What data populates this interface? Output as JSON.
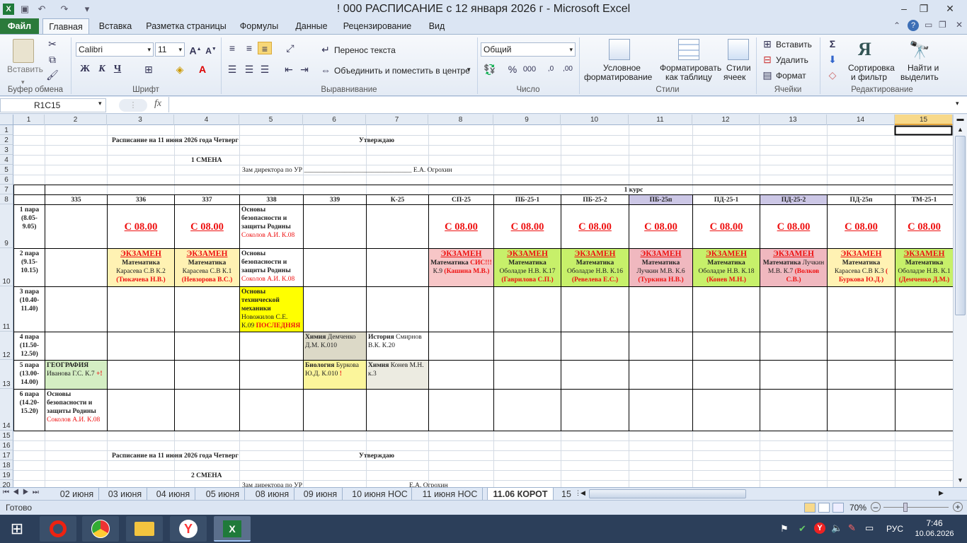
{
  "window": {
    "title": "! 000 РАСПИСАНИЕ с 12 января 2026 г  -  Microsoft Excel"
  },
  "ribbon": {
    "tabs": [
      "Файл",
      "Главная",
      "Вставка",
      "Разметка страницы",
      "Формулы",
      "Данные",
      "Рецензирование",
      "Вид"
    ],
    "clipboard": {
      "paste": "Вставить",
      "label": "Буфер обмена"
    },
    "font": {
      "name": "Calibri",
      "size": "11",
      "label": "Шрифт"
    },
    "alignment": {
      "wrap": "Перенос текста",
      "merge": "Объединить и поместить в центре",
      "label": "Выравнивание"
    },
    "number": {
      "format": "Общий",
      "label": "Число"
    },
    "styles": {
      "cond1": "Условное",
      "cond2": "форматирование",
      "table1": "Форматировать",
      "table2": "как таблицу",
      "cell1": "Стили",
      "cell2": "ячеек",
      "label": "Стили"
    },
    "cells": {
      "insert": "Вставить",
      "delete": "Удалить",
      "format": "Формат",
      "label": "Ячейки"
    },
    "editing": {
      "sort1": "Сортировка",
      "sort2": "и фильтр",
      "find1": "Найти и",
      "find2": "выделить",
      "label": "Редактирование"
    }
  },
  "formula_bar": {
    "name_box": "R1C15",
    "fx": "fx",
    "value": ""
  },
  "columns": [
    "1",
    "2",
    "3",
    "4",
    "5",
    "6",
    "7",
    "8",
    "9",
    "10",
    "11",
    "12",
    "13",
    "14",
    "15"
  ],
  "rows": [
    "1",
    "2",
    "3",
    "4",
    "5",
    "6",
    "7",
    "8",
    "9",
    "10",
    "11",
    "12",
    "13",
    "14",
    "15",
    "16",
    "17",
    "18",
    "19",
    "20"
  ],
  "sheet": {
    "r2_title": "Расписание на 11 июня 2026 года  Четверг",
    "r2_approve": "Утверждаю",
    "r4_shift": "1 СМЕНА",
    "r5_deputy": "Зам директора по УР ________________________________ Е.А. Огрохин",
    "r7_course": "1 курс",
    "groups": [
      "335",
      "336",
      "337",
      "338",
      "339",
      "К-25",
      "СП-25",
      "ПБ-25-1",
      "ПБ-25-2",
      "ПБ-25п",
      "ПД-25-1",
      "ПД-25-2",
      "ПД-25п",
      "ТМ-25-1"
    ],
    "pairs": [
      [
        "1 пара",
        "(8.05-",
        "9.05)"
      ],
      [
        "2 пара",
        "(9.15-",
        "10.15)"
      ],
      [
        "3 пара",
        "(10.40-",
        "11.40)"
      ],
      [
        "4 пара",
        "(11.50-",
        "12.50)"
      ],
      [
        "5 пара",
        "(13.00-",
        "14.00)"
      ],
      [
        "6 пара",
        "(14.20-",
        "15.20)"
      ]
    ],
    "c08": "С 08.00",
    "exam": "ЭКЗАМЕН",
    "r9_338": {
      "subj": "Основы безопасности и защиты Родины",
      "teacher": "Соколов А.И. К.08"
    },
    "r10_338": {
      "subj": "Основы безопасности и защиты Родины",
      "teacher": "Соколов А.И. К.08"
    },
    "r10_336": {
      "subj": "Математика",
      "teacher": "Карасева С.В К.2",
      "note": "(Тюкачева Н.В.)"
    },
    "r10_337": {
      "subj": "Математика",
      "teacher": "Карасева С.В К.1",
      "note": "(Невзорова В.С.)"
    },
    "r10_sp25": {
      "subj": "Математика",
      "mark": "СИС!!!",
      "room": "К.9",
      "note": "(Кашина М.В.)"
    },
    "r10_pb251": {
      "subj": "Математика",
      "teacher": "Оболадзе Н.В. К.17",
      "note": "(Гаврилова С.П.)"
    },
    "r10_pb252": {
      "subj": "Математика",
      "teacher": "Оболадзе Н.В. К.16",
      "note": "(Ревелева Е.С.)"
    },
    "r10_pb25p": {
      "subj": "Математика",
      "teacher": "Лучкин М.В. К.6",
      "note": "(Туркина Н.В.)"
    },
    "r10_pd251": {
      "subj": "Математика",
      "teacher": "Оболадзе Н.В. К.18",
      "note": "(Конев М.Н.)"
    },
    "r10_pd252": {
      "subj": "Математика",
      "teacher": "Лучкин М.В. К.7",
      "note": "(Волков С.В.)"
    },
    "r10_pd25p": {
      "subj": "Математика",
      "teacher": "Карасева С.В К.3",
      "note": "( Буркова Ю.Д.)"
    },
    "r10_tm251": {
      "subj": "Математика",
      "teacher": "Оболадзе Н.В. К.1",
      "note": "(Демченко Д.М.)"
    },
    "r11_338": {
      "subj": "Основы технической механики",
      "teacher": "Новожилов С.Е. К.09",
      "mark": "ПОСЛЕДНЯЯ"
    },
    "r12_339": {
      "subj": "Химия",
      "teacher": "Демченко Д.М. К.010"
    },
    "r12_k25": {
      "subj": "История",
      "teacher": "Смирнов В.К. К.20"
    },
    "r13_335": {
      "subj": "ГЕОГРАФИЯ",
      "teacher": "Иванова Г.С. К.7",
      "mark": "+!"
    },
    "r13_339": {
      "subj": "Биология",
      "teacher": "Буркова Ю.Д. К.010",
      "mark": "!"
    },
    "r13_k25": {
      "subj": "Химия",
      "teacher": "Конев М.Н. к.3"
    },
    "r14_335": {
      "subj": "Основы безопасности и защиты Родины",
      "teacher": "Соколов А.И. К.08"
    },
    "r17_title": "Расписание на 11 июня 2026 года  Четверг",
    "r17_approve": "Утверждаю",
    "r19_shift": "2 СМЕНА",
    "r20_deputy": "Зам директора по УР",
    "r20_name": "Е.А. Огрохин"
  },
  "sheet_tabs": [
    "02 июня",
    "03 июня",
    "04 июня",
    "05 июня",
    "08 июня",
    "09 июня",
    "10 июня НОС",
    "11 июня НОС",
    "11.06 КОРОТ",
    "15"
  ],
  "status": {
    "ready": "Готово",
    "zoom": "70%"
  },
  "taskbar": {
    "lang": "РУС",
    "time": "7:46",
    "date": "10.06.2026"
  }
}
